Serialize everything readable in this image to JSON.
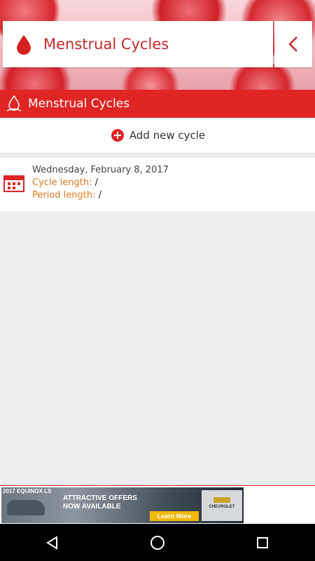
{
  "header": {
    "title": "Menstrual Cycles"
  },
  "appbar": {
    "title": "Menstrual Cycles"
  },
  "add_cycle": {
    "label": "Add new cycle"
  },
  "cycles": [
    {
      "date": "Wednesday, February 8, 2017",
      "cycle_length_label": "Cycle length:",
      "cycle_length_value": "/",
      "period_length_label": "Period length:",
      "period_length_value": "/"
    }
  ],
  "ad": {
    "year_model": "2017 EQUINOX LS",
    "headline": "ATTRACTIVE OFFERS NOW AVAILABLE",
    "cta": "Learn More",
    "brand": "CHEVROLET"
  },
  "colors": {
    "accent_red": "#e02525",
    "title_red": "#c72a2a",
    "label_orange": "#e27a1f"
  },
  "icons": {
    "drop": "blood-drop-icon",
    "back": "chevron-left-icon",
    "appbar": "app-logo-icon",
    "add": "add-icon",
    "calendar": "calendar-icon",
    "nav_back": "nav-back-icon",
    "nav_home": "nav-home-icon",
    "nav_recents": "nav-recents-icon"
  }
}
